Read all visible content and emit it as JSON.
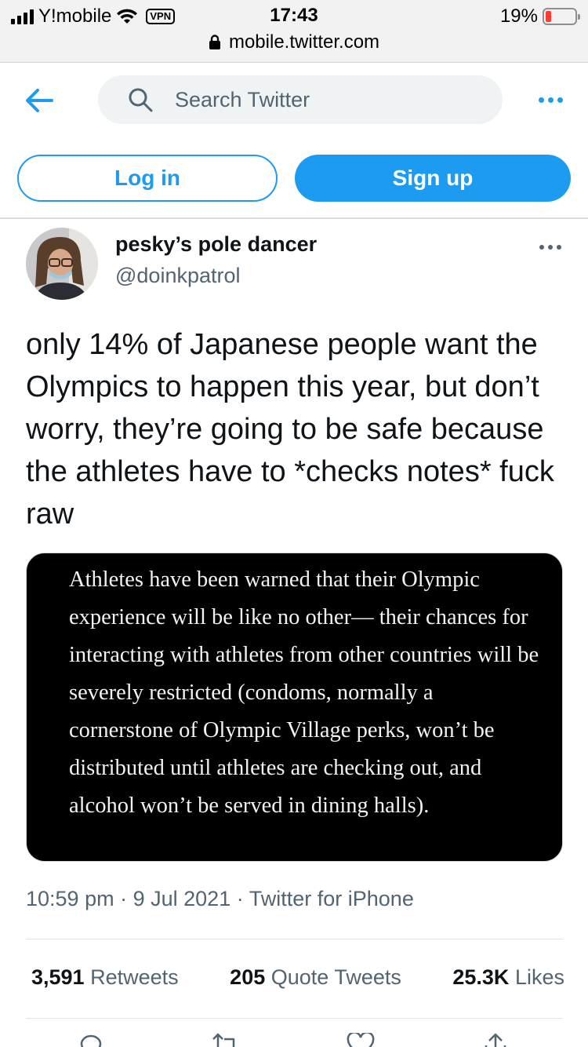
{
  "status_bar": {
    "carrier": "Y!mobile",
    "vpn": "VPN",
    "time": "17:43",
    "battery_percent": "19%",
    "battery_level": 0.19
  },
  "url_bar": {
    "url": "mobile.twitter.com"
  },
  "header": {
    "search_placeholder": "Search Twitter"
  },
  "auth": {
    "login_label": "Log in",
    "signup_label": "Sign up"
  },
  "tweet": {
    "author_name": "pesky’s pole dancer",
    "author_handle": "@doinkpatrol",
    "text": "only 14% of Japanese people want the Olympics to happen this year, but don’t worry, they’re going to be safe because the athletes have to *checks notes* fuck raw",
    "image_text": "Athletes have been warned that their Olympic experience will be like no other— their chances for interacting with athletes from other countries will be severely restricted (condoms, normally a cornerstone of Olympic Village perks, won’t be distributed until athletes are checking out, and alcohol won’t be served in dining halls).",
    "time": "10:59 pm",
    "date": "9 Jul 2021",
    "source": "Twitter for iPhone",
    "separator": "·",
    "retweets_count": "3,591",
    "retweets_label": "Retweets",
    "quotes_count": "205",
    "quotes_label": "Quote Tweets",
    "likes_count": "25.3K",
    "likes_label": "Likes"
  },
  "colors": {
    "accent": "#1d9bf0",
    "secondary_text": "#536471",
    "battery_low": "#ff3b30"
  },
  "icons": [
    "signal-icon",
    "wifi-icon",
    "lock-icon",
    "battery-icon",
    "back-arrow-icon",
    "search-icon",
    "more-icon",
    "reply-icon",
    "retweet-icon",
    "like-icon",
    "share-icon"
  ]
}
